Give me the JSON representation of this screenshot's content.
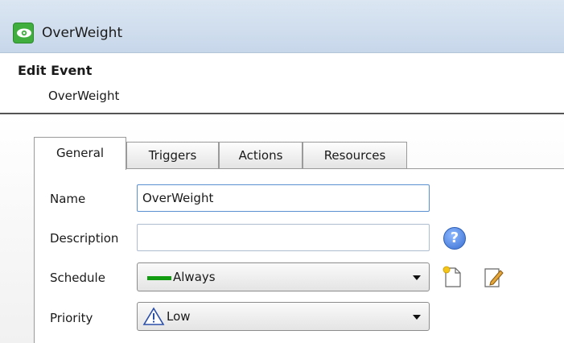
{
  "window": {
    "title": "OverWeight",
    "icon": "eye-icon",
    "accent": "#3fae3f"
  },
  "header": {
    "title": "Edit Event",
    "subtitle": "OverWeight"
  },
  "tabs": [
    {
      "label": "General",
      "active": true
    },
    {
      "label": "Triggers",
      "active": false
    },
    {
      "label": "Actions",
      "active": false
    },
    {
      "label": "Resources",
      "active": false
    }
  ],
  "form": {
    "name": {
      "label": "Name",
      "value": "OverWeight"
    },
    "description": {
      "label": "Description",
      "value": ""
    },
    "schedule": {
      "label": "Schedule",
      "selected": "Always",
      "color": "#129c12"
    },
    "priority": {
      "label": "Priority",
      "selected": "Low"
    }
  },
  "icons": {
    "help": "?",
    "new_schedule": "new-document-icon",
    "edit_schedule": "edit-pencil-icon",
    "priority": "warning-triangle-icon"
  }
}
